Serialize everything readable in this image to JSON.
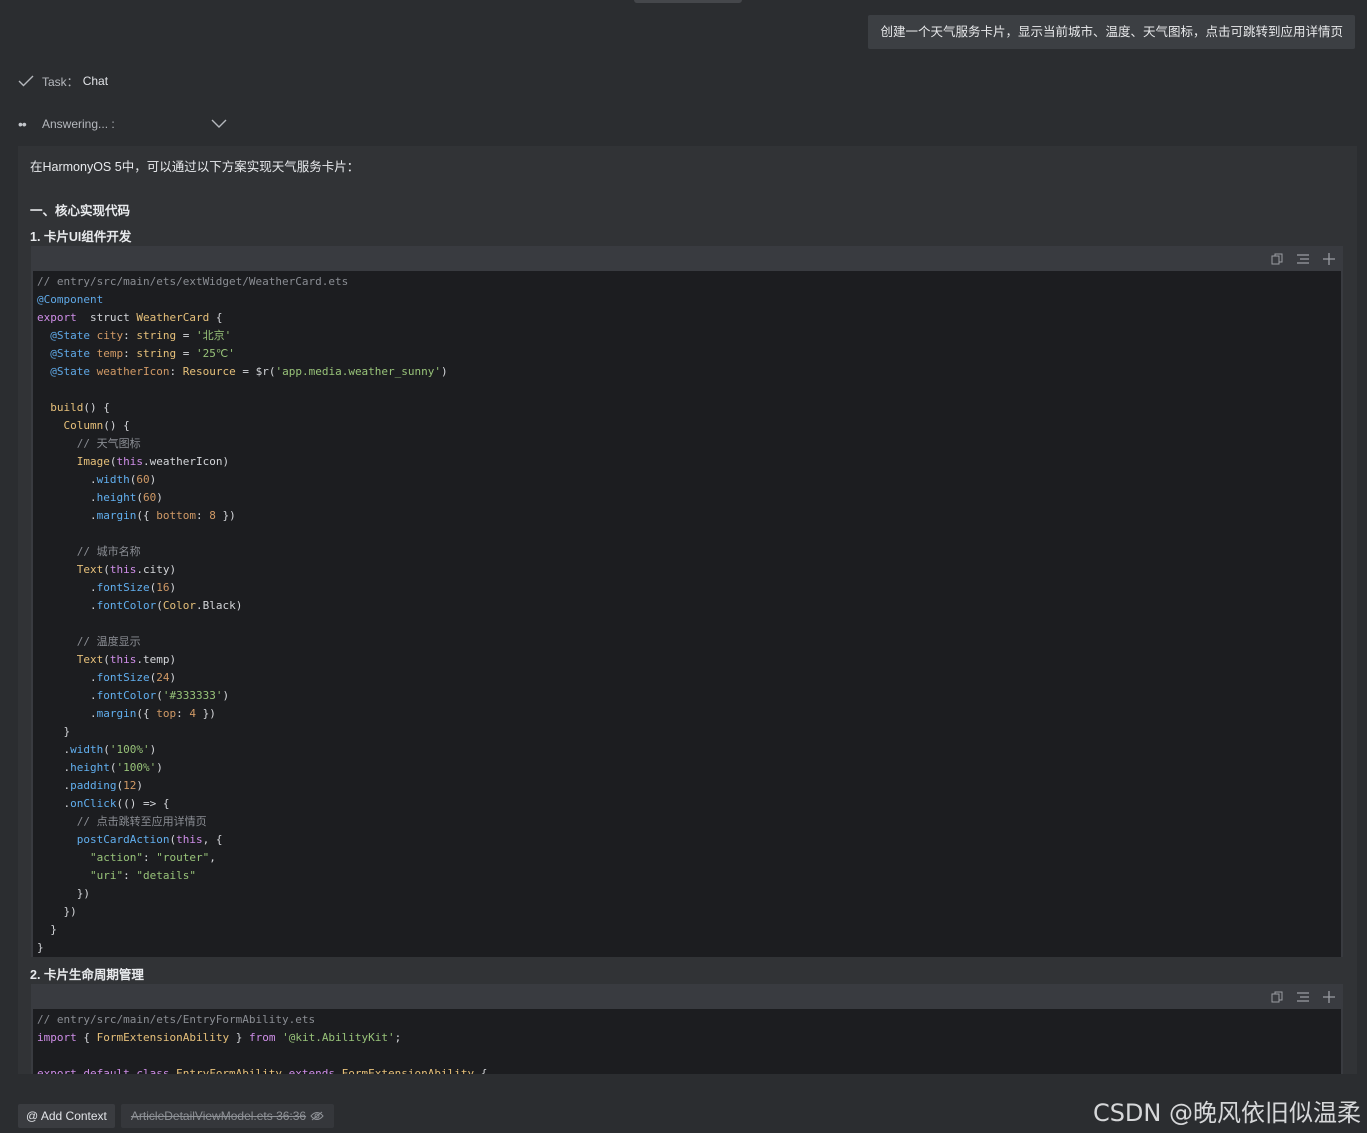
{
  "user_message": "创建一个天气服务卡片，显示当前城市、温度、天气图标，点击可跳转到应用详情页",
  "task": {
    "label": "Task：",
    "value": "Chat"
  },
  "answering": {
    "label": "Answering... :"
  },
  "answer": {
    "intro": "在HarmonyOS 5中，可以通过以下方案实现天气服务卡片：",
    "section1": "一、核心实现代码",
    "sub1": "1. 卡片UI组件开发",
    "sub2": "2. 卡片生命周期管理"
  },
  "code1": [
    [
      [
        "cm",
        "// entry/src/main/ets/extWidget/WeatherCard.ets"
      ]
    ],
    [
      [
        "an",
        "@Component"
      ]
    ],
    [
      [
        "kw",
        "export"
      ],
      [
        "",
        "  struct "
      ],
      [
        "fn",
        "WeatherCard"
      ],
      [
        "",
        " {"
      ]
    ],
    [
      [
        "",
        "  "
      ],
      [
        "an",
        "@State"
      ],
      [
        "",
        " "
      ],
      [
        "pr",
        "city"
      ],
      [
        "",
        ": "
      ],
      [
        "fn",
        "string"
      ],
      [
        "",
        " = "
      ],
      [
        "st",
        "'北京'"
      ]
    ],
    [
      [
        "",
        "  "
      ],
      [
        "an",
        "@State"
      ],
      [
        "",
        " "
      ],
      [
        "pr",
        "temp"
      ],
      [
        "",
        ": "
      ],
      [
        "fn",
        "string"
      ],
      [
        "",
        " = "
      ],
      [
        "st",
        "'25℃'"
      ]
    ],
    [
      [
        "",
        "  "
      ],
      [
        "an",
        "@State"
      ],
      [
        "",
        " "
      ],
      [
        "pr",
        "weatherIcon"
      ],
      [
        "",
        ": "
      ],
      [
        "fn",
        "Resource"
      ],
      [
        "",
        " = $r("
      ],
      [
        "st",
        "'app.media.weather_sunny'"
      ],
      [
        "",
        ")"
      ]
    ],
    [
      [
        "",
        ""
      ]
    ],
    [
      [
        "",
        "  "
      ],
      [
        "fn",
        "build"
      ],
      [
        "",
        "() {"
      ]
    ],
    [
      [
        "",
        "    "
      ],
      [
        "fn",
        "Column"
      ],
      [
        "",
        "() {"
      ]
    ],
    [
      [
        "",
        "      "
      ],
      [
        "cm",
        "// 天气图标"
      ]
    ],
    [
      [
        "",
        "      "
      ],
      [
        "fn",
        "Image"
      ],
      [
        "",
        "("
      ],
      [
        "kw",
        "this"
      ],
      [
        "",
        ".weatherIcon)"
      ]
    ],
    [
      [
        "",
        "        ."
      ],
      [
        "me",
        "width"
      ],
      [
        "",
        "("
      ],
      [
        "nm",
        "60"
      ],
      [
        "",
        ")"
      ]
    ],
    [
      [
        "",
        "        ."
      ],
      [
        "me",
        "height"
      ],
      [
        "",
        "("
      ],
      [
        "nm",
        "60"
      ],
      [
        "",
        ")"
      ]
    ],
    [
      [
        "",
        "        ."
      ],
      [
        "me",
        "margin"
      ],
      [
        "",
        "({ "
      ],
      [
        "pr",
        "bottom"
      ],
      [
        "",
        ": "
      ],
      [
        "nm",
        "8"
      ],
      [
        "",
        " })"
      ]
    ],
    [
      [
        "",
        ""
      ]
    ],
    [
      [
        "",
        "      "
      ],
      [
        "cm",
        "// 城市名称"
      ]
    ],
    [
      [
        "",
        "      "
      ],
      [
        "fn",
        "Text"
      ],
      [
        "",
        "("
      ],
      [
        "kw",
        "this"
      ],
      [
        "",
        ".city)"
      ]
    ],
    [
      [
        "",
        "        ."
      ],
      [
        "me",
        "fontSize"
      ],
      [
        "",
        "("
      ],
      [
        "nm",
        "16"
      ],
      [
        "",
        ")"
      ]
    ],
    [
      [
        "",
        "        ."
      ],
      [
        "me",
        "fontColor"
      ],
      [
        "",
        "("
      ],
      [
        "fn",
        "Color"
      ],
      [
        "",
        ".Black)"
      ]
    ],
    [
      [
        "",
        ""
      ]
    ],
    [
      [
        "",
        "      "
      ],
      [
        "cm",
        "// 温度显示"
      ]
    ],
    [
      [
        "",
        "      "
      ],
      [
        "fn",
        "Text"
      ],
      [
        "",
        "("
      ],
      [
        "kw",
        "this"
      ],
      [
        "",
        ".temp)"
      ]
    ],
    [
      [
        "",
        "        ."
      ],
      [
        "me",
        "fontSize"
      ],
      [
        "",
        "("
      ],
      [
        "nm",
        "24"
      ],
      [
        "",
        ")"
      ]
    ],
    [
      [
        "",
        "        ."
      ],
      [
        "me",
        "fontColor"
      ],
      [
        "",
        "("
      ],
      [
        "st",
        "'#333333'"
      ],
      [
        "",
        ")"
      ]
    ],
    [
      [
        "",
        "        ."
      ],
      [
        "me",
        "margin"
      ],
      [
        "",
        "({ "
      ],
      [
        "pr",
        "top"
      ],
      [
        "",
        ": "
      ],
      [
        "nm",
        "4"
      ],
      [
        "",
        " })"
      ]
    ],
    [
      [
        "",
        "    }"
      ]
    ],
    [
      [
        "",
        "    ."
      ],
      [
        "me",
        "width"
      ],
      [
        "",
        "("
      ],
      [
        "st",
        "'100%'"
      ],
      [
        "",
        ")"
      ]
    ],
    [
      [
        "",
        "    ."
      ],
      [
        "me",
        "height"
      ],
      [
        "",
        "("
      ],
      [
        "st",
        "'100%'"
      ],
      [
        "",
        ")"
      ]
    ],
    [
      [
        "",
        "    ."
      ],
      [
        "me",
        "padding"
      ],
      [
        "",
        "("
      ],
      [
        "nm",
        "12"
      ],
      [
        "",
        ")"
      ]
    ],
    [
      [
        "",
        "    ."
      ],
      [
        "me",
        "onClick"
      ],
      [
        "",
        "(() => {"
      ]
    ],
    [
      [
        "",
        "      "
      ],
      [
        "cm",
        "// 点击跳转至应用详情页"
      ]
    ],
    [
      [
        "",
        "      "
      ],
      [
        "me",
        "postCardAction"
      ],
      [
        "",
        "("
      ],
      [
        "kw",
        "this"
      ],
      [
        "",
        ", {"
      ]
    ],
    [
      [
        "",
        "        "
      ],
      [
        "st",
        "\"action\""
      ],
      [
        "",
        ": "
      ],
      [
        "st",
        "\"router\""
      ],
      [
        "",
        ","
      ]
    ],
    [
      [
        "",
        "        "
      ],
      [
        "st",
        "\"uri\""
      ],
      [
        "",
        ": "
      ],
      [
        "st",
        "\"details\""
      ]
    ],
    [
      [
        "",
        "      })"
      ]
    ],
    [
      [
        "",
        "    })"
      ]
    ],
    [
      [
        "",
        "  }"
      ]
    ],
    [
      [
        "",
        "}"
      ]
    ]
  ],
  "code2": [
    [
      [
        "cm",
        "// entry/src/main/ets/EntryFormAbility.ets"
      ]
    ],
    [
      [
        "kw",
        "import"
      ],
      [
        "",
        " { "
      ],
      [
        "fn",
        "FormExtensionAbility"
      ],
      [
        "",
        " } "
      ],
      [
        "kw",
        "from"
      ],
      [
        "",
        " "
      ],
      [
        "st",
        "'@kit.AbilityKit'"
      ],
      [
        "",
        ";"
      ]
    ],
    [
      [
        "",
        ""
      ]
    ],
    [
      [
        "kw",
        "export default class"
      ],
      [
        "",
        " "
      ],
      [
        "fn",
        "EntryFormAbility"
      ],
      [
        "",
        " "
      ],
      [
        "kw",
        "extends"
      ],
      [
        "",
        " "
      ],
      [
        "fn",
        "FormExtensionAbility"
      ],
      [
        "",
        " {"
      ]
    ]
  ],
  "bottom": {
    "add_context": "@ Add Context",
    "file_chip": "ArticleDetailViewModel.ets 36:36"
  },
  "watermark": "CSDN @晚风依旧似温柔"
}
